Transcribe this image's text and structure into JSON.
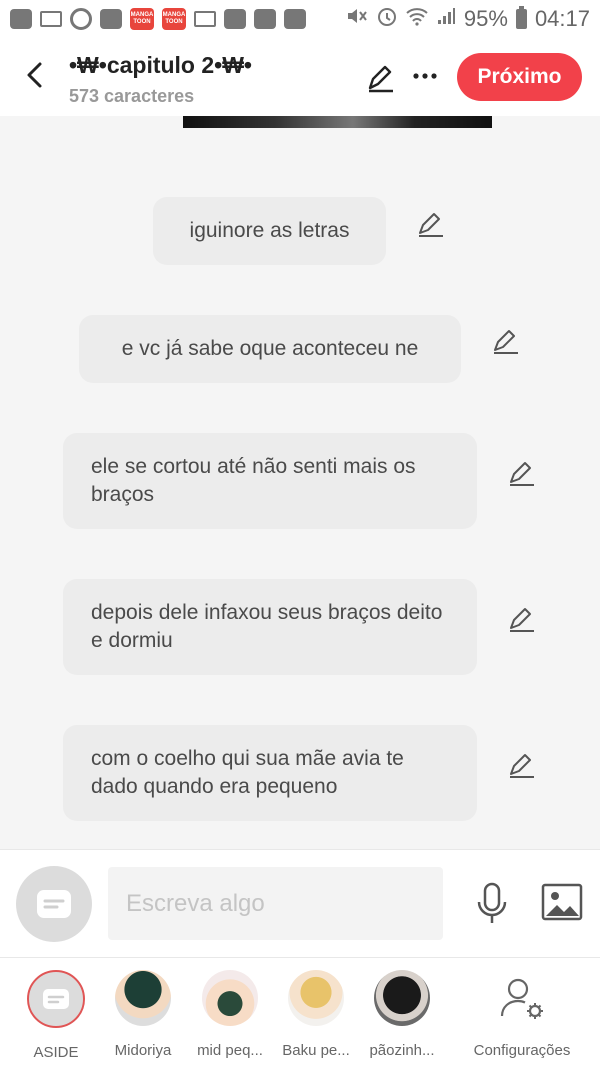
{
  "status_bar": {
    "manga_badge_1": "MANGA TOON",
    "manga_badge_2": "MANGA TOON",
    "battery": "95%",
    "time": "04:17"
  },
  "header": {
    "title": "•₩•capitulo 2•₩•",
    "subtitle": "573 caracteres",
    "next_label": "Próximo"
  },
  "messages": [
    {
      "text": "iguinore as letras"
    },
    {
      "text": "e vc já sabe oque aconteceu ne"
    },
    {
      "text": "ele se cortou até não senti mais os braços"
    },
    {
      "text": "depois dele infaxou seus braços deito e dormiu"
    },
    {
      "text": "com o coelho qui sua mãe avia te dado quando era pequeno"
    }
  ],
  "input": {
    "placeholder": "Escreva algo"
  },
  "characters": [
    {
      "name": "ASIDE"
    },
    {
      "name": "Midoriya"
    },
    {
      "name": "mid peq..."
    },
    {
      "name": "Baku pe..."
    },
    {
      "name": "pãozinh..."
    },
    {
      "name": "Configurações"
    }
  ],
  "colors": {
    "accent": "#f2414a",
    "bubble": "#ececec",
    "background": "#f5f5f5"
  },
  "icons": {
    "back": "chevron-left-icon",
    "edit": "pencil-icon",
    "more": "more-dots-icon",
    "mic": "microphone-icon",
    "gallery": "image-icon",
    "settings": "person-gear-icon"
  }
}
